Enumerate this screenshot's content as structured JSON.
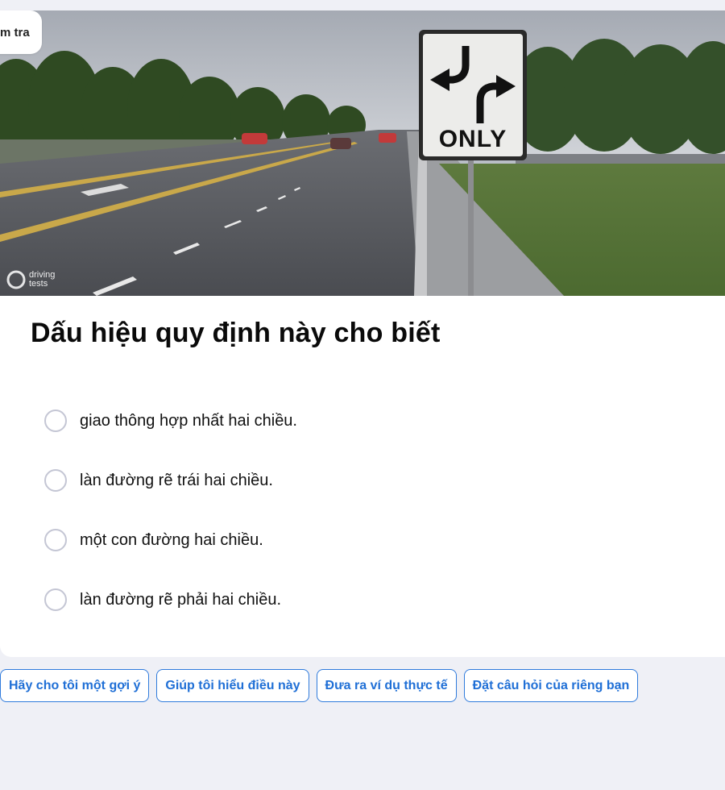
{
  "header": {
    "tab_label": "m tra"
  },
  "hero_image": {
    "sign_text": "ONLY",
    "watermark_line1": "driving",
    "watermark_line2": "tests",
    "sign_icon": "two-way-left-turn-arrows-icon"
  },
  "question": {
    "title": "Dấu hiệu quy định này cho biết"
  },
  "options": [
    {
      "label": "giao thông hợp nhất hai chiều."
    },
    {
      "label": "làn đường rẽ trái hai chiều."
    },
    {
      "label": "một con đường hai chiều."
    },
    {
      "label": "làn đường rẽ phải hai chiều."
    }
  ],
  "help_chips": [
    {
      "label": "Hãy cho tôi một gợi ý"
    },
    {
      "label": "Giúp tôi hiểu điều này"
    },
    {
      "label": "Đưa ra ví dụ thực tế"
    },
    {
      "label": "Đặt câu hỏi của riêng bạn"
    }
  ],
  "colors": {
    "page_bg": "#eff0f6",
    "card_bg": "#ffffff",
    "accent": "#1f6fd6",
    "radio_border": "#c4c6d4"
  }
}
